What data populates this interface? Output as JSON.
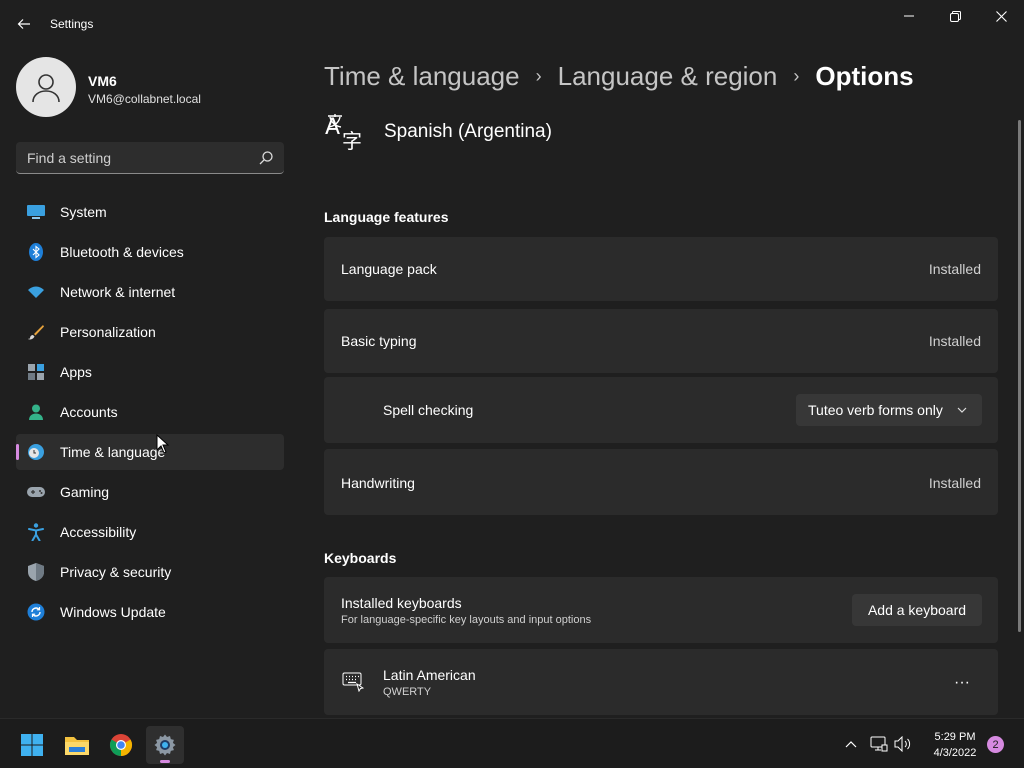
{
  "window": {
    "title": "Settings"
  },
  "user": {
    "name": "VM6",
    "email": "VM6@collabnet.local"
  },
  "search": {
    "placeholder": "Find a setting"
  },
  "sidebar": {
    "items": [
      {
        "label": "System",
        "icon": "system-icon"
      },
      {
        "label": "Bluetooth & devices",
        "icon": "bluetooth-icon"
      },
      {
        "label": "Network & internet",
        "icon": "network-icon"
      },
      {
        "label": "Personalization",
        "icon": "brush-icon"
      },
      {
        "label": "Apps",
        "icon": "apps-icon"
      },
      {
        "label": "Accounts",
        "icon": "accounts-icon"
      },
      {
        "label": "Time & language",
        "icon": "time-language-icon",
        "active": true
      },
      {
        "label": "Gaming",
        "icon": "gaming-icon"
      },
      {
        "label": "Accessibility",
        "icon": "accessibility-icon"
      },
      {
        "label": "Privacy & security",
        "icon": "shield-icon"
      },
      {
        "label": "Windows Update",
        "icon": "update-icon"
      }
    ]
  },
  "breadcrumb": {
    "items": [
      "Time & language",
      "Language & region"
    ],
    "current": "Options",
    "separator": "›"
  },
  "language": {
    "name": "Spanish (Argentina)"
  },
  "language_features": {
    "title": "Language features",
    "language_pack": {
      "label": "Language pack",
      "status": "Installed"
    },
    "basic_typing": {
      "label": "Basic typing",
      "status": "Installed"
    },
    "spell_checking": {
      "label": "Spell checking",
      "value": "Tuteo verb forms only"
    },
    "handwriting": {
      "label": "Handwriting",
      "status": "Installed"
    }
  },
  "keyboards": {
    "title": "Keyboards",
    "installed": {
      "label": "Installed keyboards",
      "description": "For language-specific key layouts and input options",
      "button": "Add a keyboard"
    },
    "items": [
      {
        "name": "Latin American",
        "layout": "QWERTY",
        "more": "···"
      }
    ]
  },
  "taskbar": {
    "apps": [
      "start-icon",
      "file-explorer-icon",
      "chrome-icon",
      "settings-icon"
    ],
    "time": "5:29 PM",
    "date": "4/3/2022",
    "notifications": "2"
  },
  "colors": {
    "background": "#1f1f1f",
    "card": "#2b2b2b",
    "accent": "#d68ae0"
  }
}
